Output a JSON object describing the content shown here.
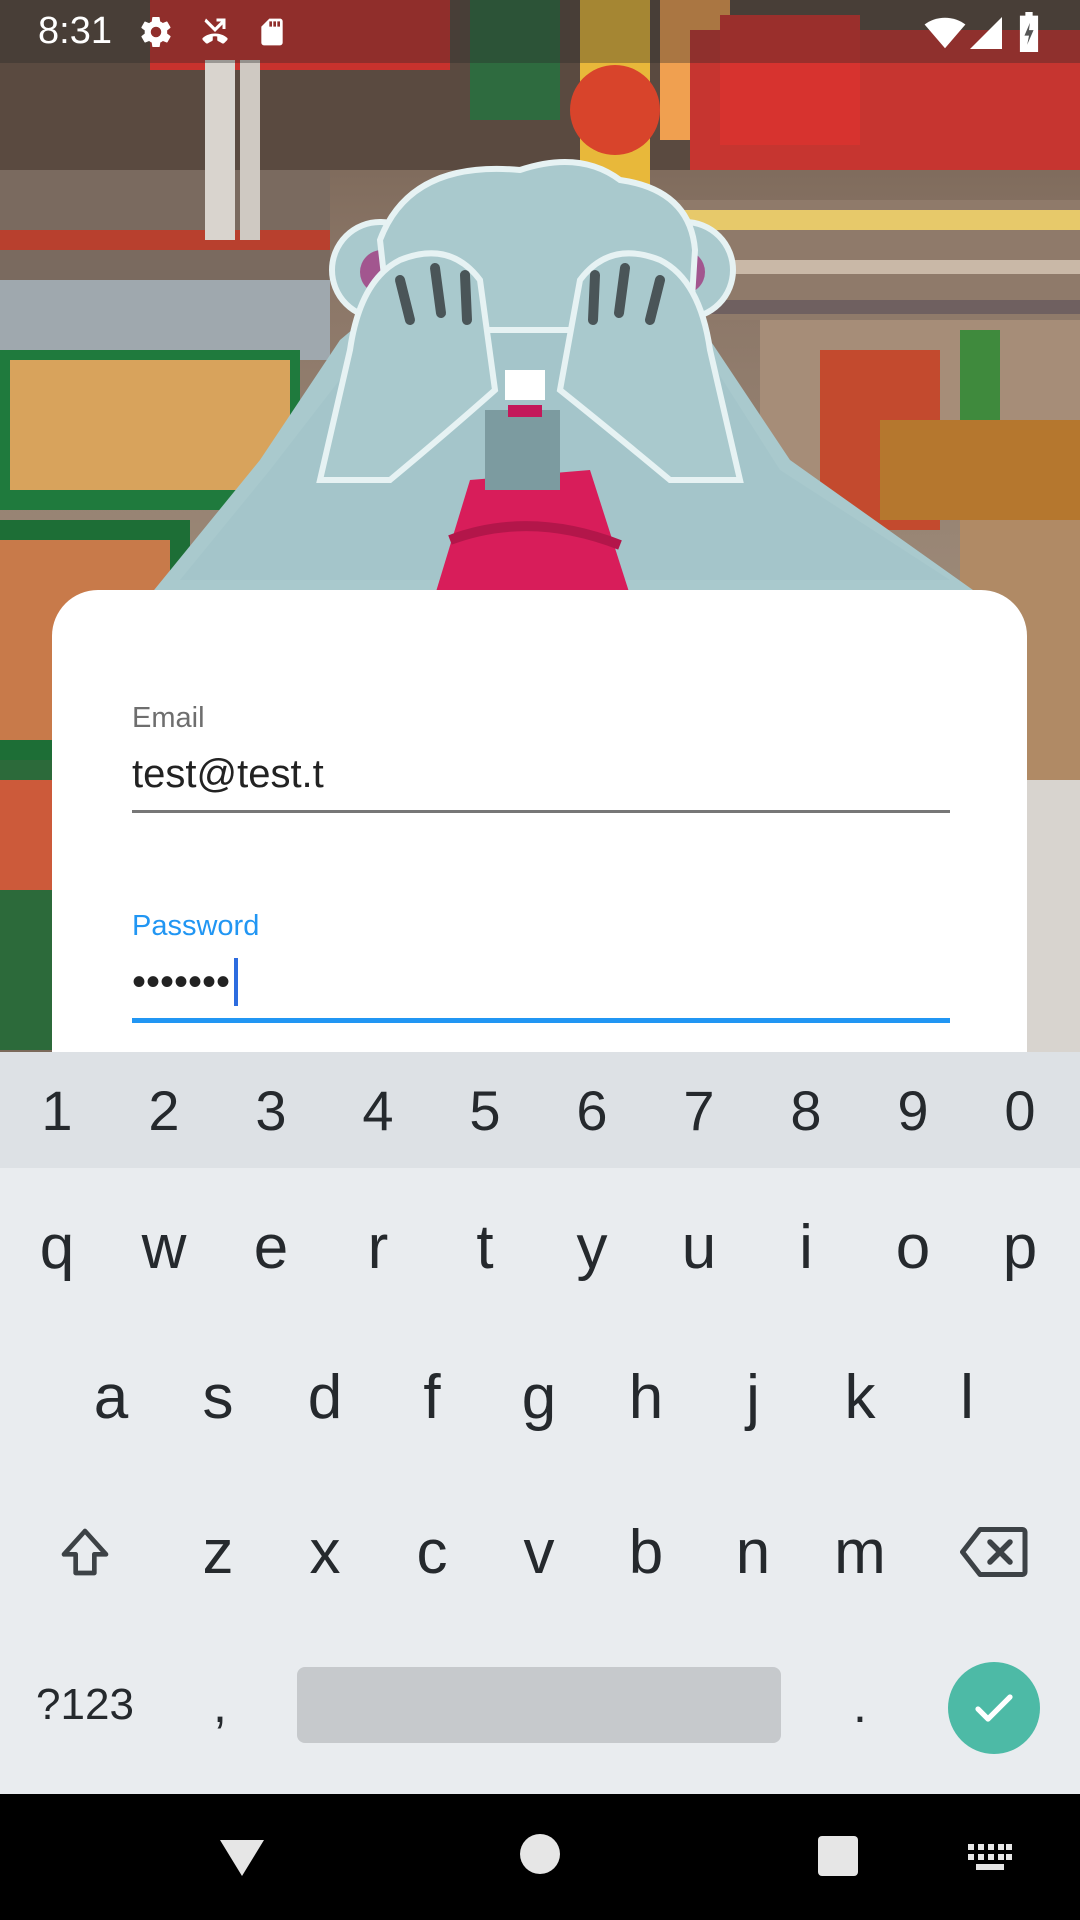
{
  "status_bar": {
    "time": "8:31",
    "icons": [
      "settings-icon",
      "missed-call-icon",
      "sd-card-icon",
      "wifi-icon",
      "signal-icon",
      "battery-charging-icon"
    ]
  },
  "login_form": {
    "email": {
      "label": "Email",
      "value": "test@test.t"
    },
    "password": {
      "label": "Password",
      "value": "•••••••"
    },
    "accent_color": "#2196f3"
  },
  "keyboard": {
    "number_row": [
      "1",
      "2",
      "3",
      "4",
      "5",
      "6",
      "7",
      "8",
      "9",
      "0"
    ],
    "row1": [
      "q",
      "w",
      "e",
      "r",
      "t",
      "y",
      "u",
      "i",
      "o",
      "p"
    ],
    "row2": [
      "a",
      "s",
      "d",
      "f",
      "g",
      "h",
      "j",
      "k",
      "l"
    ],
    "row3": [
      "z",
      "x",
      "c",
      "v",
      "b",
      "n",
      "m"
    ],
    "symbols_key": "?123",
    "comma_key": ",",
    "period_key": ".",
    "enter_color": "#4dbaa6"
  },
  "nav_bar": {
    "icons": [
      "back-icon",
      "home-icon",
      "recents-icon",
      "keyboard-switch-icon"
    ]
  }
}
